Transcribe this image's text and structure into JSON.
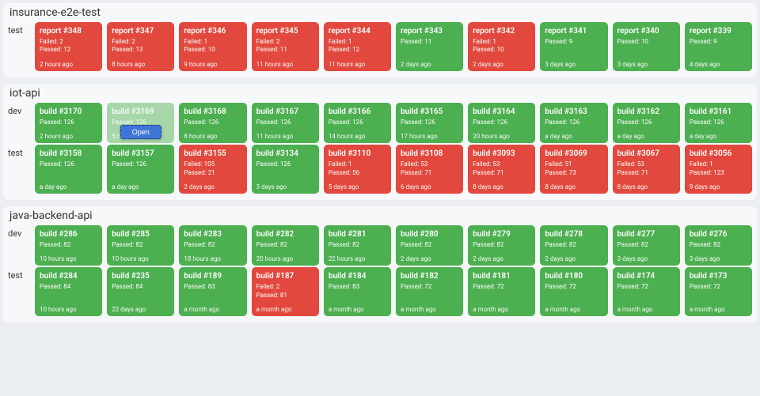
{
  "open_button_label": "Open",
  "projects": [
    {
      "name": "insurance-e2e-test",
      "envs": [
        {
          "label": "test",
          "cards": [
            {
              "title": "report #348",
              "status": "failure",
              "failed": "Failed: 2",
              "passed": "Passed: 12",
              "time": "2 hours ago"
            },
            {
              "title": "report #347",
              "status": "failure",
              "failed": "Failed: 2",
              "passed": "Passed: 13",
              "time": "8 hours ago"
            },
            {
              "title": "report #346",
              "status": "failure",
              "failed": "Failed: 1",
              "passed": "Passed: 10",
              "time": "9 hours ago"
            },
            {
              "title": "report #345",
              "status": "failure",
              "failed": "Failed: 2",
              "passed": "Passed: 11",
              "time": "11 hours ago"
            },
            {
              "title": "report #344",
              "status": "failure",
              "failed": "Failed: 1",
              "passed": "Passed: 12",
              "time": "11 hours ago"
            },
            {
              "title": "report #343",
              "status": "success",
              "failed": "",
              "passed": "Passed: 11",
              "time": "2 days ago"
            },
            {
              "title": "report #342",
              "status": "failure",
              "failed": "Failed: 1",
              "passed": "Passed: 10",
              "time": "2 days ago"
            },
            {
              "title": "report #341",
              "status": "success",
              "failed": "",
              "passed": "Passed: 9",
              "time": "3 days ago"
            },
            {
              "title": "report #340",
              "status": "success",
              "failed": "",
              "passed": "Passed: 10",
              "time": "3 days ago"
            },
            {
              "title": "report #339",
              "status": "success",
              "failed": "",
              "passed": "Passed: 9",
              "time": "4 days ago"
            }
          ]
        }
      ]
    },
    {
      "name": "iot-api",
      "envs": [
        {
          "label": "dev",
          "cards": [
            {
              "title": "build #3170",
              "status": "success",
              "failed": "",
              "passed": "Passed: 126",
              "time": "2 hours ago"
            },
            {
              "title": "build #3169",
              "status": "selected",
              "failed": "",
              "passed": "Passed: 126",
              "time": "5 hours ago",
              "open": true
            },
            {
              "title": "build #3168",
              "status": "success",
              "failed": "",
              "passed": "Passed: 126",
              "time": "8 hours ago"
            },
            {
              "title": "build #3167",
              "status": "success",
              "failed": "",
              "passed": "Passed: 126",
              "time": "11 hours ago"
            },
            {
              "title": "build #3166",
              "status": "success",
              "failed": "",
              "passed": "Passed: 126",
              "time": "14 hours ago"
            },
            {
              "title": "build #3165",
              "status": "success",
              "failed": "",
              "passed": "Passed: 126",
              "time": "17 hours ago"
            },
            {
              "title": "build #3164",
              "status": "success",
              "failed": "",
              "passed": "Passed: 126",
              "time": "20 hours ago"
            },
            {
              "title": "build #3163",
              "status": "success",
              "failed": "",
              "passed": "Passed: 126",
              "time": "a day ago"
            },
            {
              "title": "build #3162",
              "status": "success",
              "failed": "",
              "passed": "Passed: 126",
              "time": "a day ago"
            },
            {
              "title": "build #3161",
              "status": "success",
              "failed": "",
              "passed": "Passed: 126",
              "time": "a day ago"
            }
          ]
        },
        {
          "label": "test",
          "cards": [
            {
              "title": "build #3158",
              "status": "success",
              "failed": "",
              "passed": "Passed: 126",
              "time": "a day ago"
            },
            {
              "title": "build #3157",
              "status": "success",
              "failed": "",
              "passed": "Passed: 126",
              "time": "a day ago"
            },
            {
              "title": "build #3155",
              "status": "failure",
              "failed": "Failed: 105",
              "passed": "Passed: 21",
              "time": "2 days ago"
            },
            {
              "title": "build #3134",
              "status": "success",
              "failed": "",
              "passed": "Passed: 126",
              "time": "3 days ago"
            },
            {
              "title": "build #3110",
              "status": "failure",
              "failed": "Failed: 1",
              "passed": "Passed: 56",
              "time": "5 days ago"
            },
            {
              "title": "build #3108",
              "status": "failure",
              "failed": "Failed: 53",
              "passed": "Passed: 71",
              "time": "6 days ago"
            },
            {
              "title": "build #3093",
              "status": "failure",
              "failed": "Failed: 53",
              "passed": "Passed: 71",
              "time": "8 days ago"
            },
            {
              "title": "build #3069",
              "status": "failure",
              "failed": "Failed: 51",
              "passed": "Passed: 73",
              "time": "8 days ago"
            },
            {
              "title": "build #3067",
              "status": "failure",
              "failed": "Failed: 53",
              "passed": "Passed: 71",
              "time": "8 days ago"
            },
            {
              "title": "build #3056",
              "status": "failure",
              "failed": "Failed: 1",
              "passed": "Passed: 123",
              "time": "9 days ago"
            }
          ]
        }
      ]
    },
    {
      "name": "java-backend-api",
      "envs": [
        {
          "label": "dev",
          "cards": [
            {
              "title": "build #286",
              "status": "success",
              "failed": "",
              "passed": "Passed: 82",
              "time": "10 hours ago"
            },
            {
              "title": "build #285",
              "status": "success",
              "failed": "",
              "passed": "Passed: 82",
              "time": "10 hours ago"
            },
            {
              "title": "build #283",
              "status": "success",
              "failed": "",
              "passed": "Passed: 82",
              "time": "18 hours ago"
            },
            {
              "title": "build #282",
              "status": "success",
              "failed": "",
              "passed": "Passed: 82",
              "time": "20 hours ago"
            },
            {
              "title": "build #281",
              "status": "success",
              "failed": "",
              "passed": "Passed: 82",
              "time": "22 hours ago"
            },
            {
              "title": "build #280",
              "status": "success",
              "failed": "",
              "passed": "Passed: 82",
              "time": "2 days ago"
            },
            {
              "title": "build #279",
              "status": "success",
              "failed": "",
              "passed": "Passed: 82",
              "time": "2 days ago"
            },
            {
              "title": "build #278",
              "status": "success",
              "failed": "",
              "passed": "Passed: 82",
              "time": "2 days ago"
            },
            {
              "title": "build #277",
              "status": "success",
              "failed": "",
              "passed": "Passed: 82",
              "time": "3 days ago"
            },
            {
              "title": "build #276",
              "status": "success",
              "failed": "",
              "passed": "Passed: 82",
              "time": "3 days ago"
            }
          ]
        },
        {
          "label": "test",
          "cards": [
            {
              "title": "build #284",
              "status": "success",
              "failed": "",
              "passed": "Passed: 84",
              "time": "10 hours ago"
            },
            {
              "title": "build #235",
              "status": "success",
              "failed": "",
              "passed": "Passed: 84",
              "time": "22 days ago"
            },
            {
              "title": "build #189",
              "status": "success",
              "failed": "",
              "passed": "Passed: 83",
              "time": "a month ago"
            },
            {
              "title": "build #187",
              "status": "failure",
              "failed": "Failed: 2",
              "passed": "Passed: 81",
              "time": "a month ago"
            },
            {
              "title": "build #184",
              "status": "success",
              "failed": "",
              "passed": "Passed: 83",
              "time": "a month ago"
            },
            {
              "title": "build #182",
              "status": "success",
              "failed": "",
              "passed": "Passed: 72",
              "time": "a month ago"
            },
            {
              "title": "build #181",
              "status": "success",
              "failed": "",
              "passed": "Passed: 72",
              "time": "a month ago"
            },
            {
              "title": "build #180",
              "status": "success",
              "failed": "",
              "passed": "Passed: 72",
              "time": "a month ago"
            },
            {
              "title": "build #174",
              "status": "success",
              "failed": "",
              "passed": "Passed: 72",
              "time": "a month ago"
            },
            {
              "title": "build #173",
              "status": "success",
              "failed": "",
              "passed": "Passed: 72",
              "time": "a month ago"
            }
          ]
        }
      ]
    }
  ]
}
